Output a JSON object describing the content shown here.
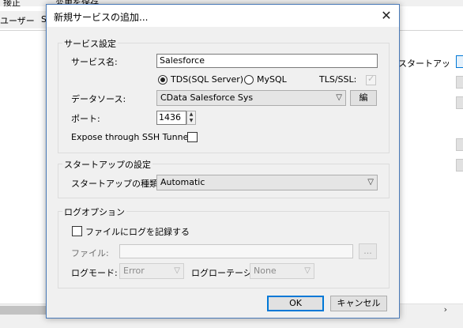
{
  "background": {
    "top_bar_items": [
      "接正",
      "変更を保存"
    ],
    "tab_label": "ユーザー",
    "tab_letter": "S",
    "right_column_text": "スタートアップの種",
    "scroll_arrow": "›"
  },
  "dialog": {
    "title": "新規サービスの追加...",
    "close_glyph": "✕",
    "service_settings": {
      "group_title": "サービス設定",
      "service_name_label": "サービス名:",
      "service_name_value": "Salesforce",
      "protocol_options": [
        {
          "label": "TDS(SQL Server)",
          "checked": true
        },
        {
          "label": "MySQL",
          "checked": false
        }
      ],
      "tls_label": "TLS/SSL:",
      "tls_checked": true,
      "datasource_label": "データソース:",
      "datasource_value": "CData Salesforce Sys",
      "edit_button": "編",
      "port_label": "ポート:",
      "port_value": "1436",
      "ssh_label": "Expose through SSH Tunnel:",
      "ssh_checked": false
    },
    "startup_settings": {
      "group_title": "スタートアップの設定",
      "type_label": "スタートアップの種類:",
      "type_value": "Automatic"
    },
    "log_options": {
      "group_title": "ログオプション",
      "log_checkbox_label": "ファイルにログを記録する",
      "log_checked": false,
      "file_label": "ファイル:",
      "file_value": "",
      "browse_button": "...",
      "mode_label": "ログモード:",
      "mode_value": "Error",
      "rotation_label": "ログローテーション:",
      "rotation_value": "None"
    },
    "ok_button": "OK",
    "cancel_button": "キャンセル"
  }
}
